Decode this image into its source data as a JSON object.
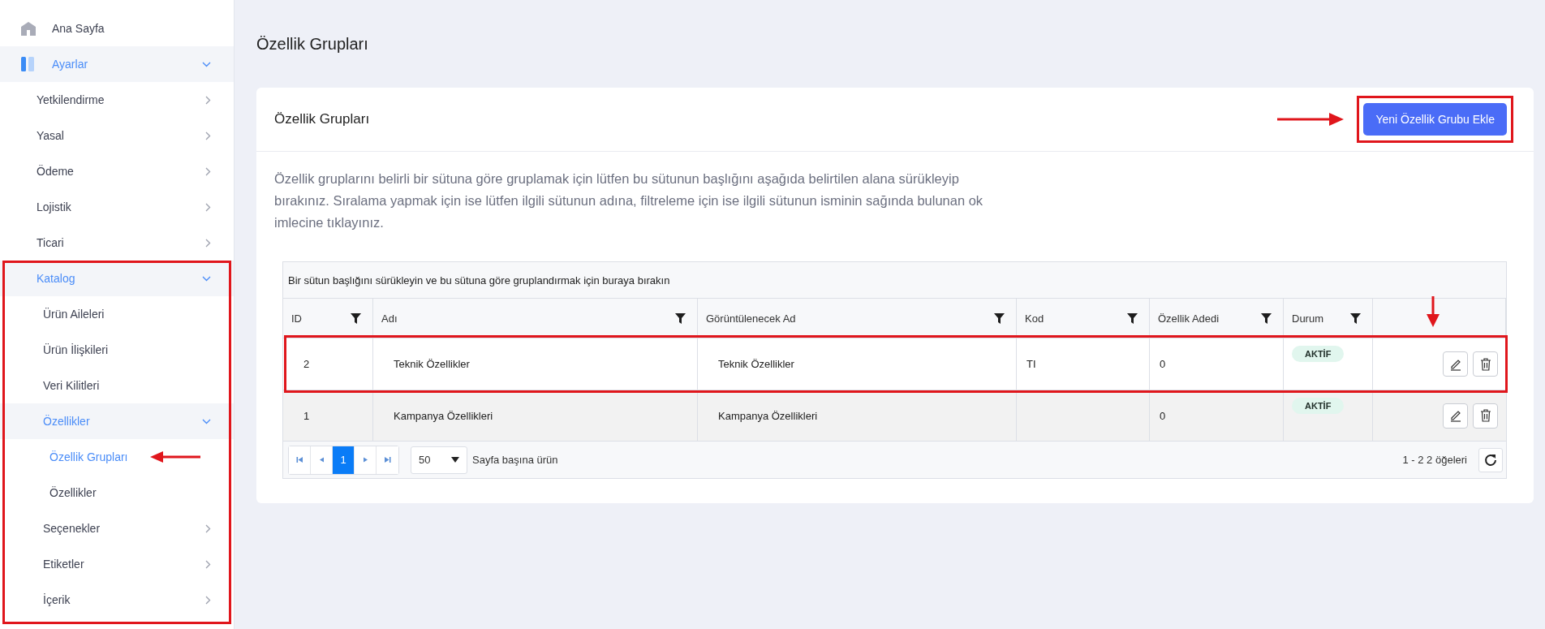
{
  "sidebar": {
    "items": [
      {
        "label": "Ana Sayfa",
        "selected": false
      },
      {
        "label": "Ayarlar",
        "expanded": true,
        "children": [
          {
            "label": "Yetkilendirme",
            "selected": false,
            "expanded": false
          },
          {
            "label": "Yasal",
            "selected": false,
            "expanded": false
          },
          {
            "label": "Ödeme",
            "selected": false,
            "expanded": false
          },
          {
            "label": "Lojistik",
            "selected": false,
            "expanded": false
          },
          {
            "label": "Ticari",
            "selected": false,
            "expanded": false
          },
          {
            "label": "Katalog",
            "expanded": true,
            "highlighted": true,
            "children": [
              {
                "label": "Ürün Aileleri",
                "selected": false
              },
              {
                "label": "Ürün İlişkileri",
                "selected": false
              },
              {
                "label": "Veri Kilitleri",
                "selected": false
              },
              {
                "label": "Özellikler",
                "expanded": true,
                "children": [
                  {
                    "label": "Özellik Grupları",
                    "selected": true,
                    "arrow": true
                  },
                  {
                    "label": "Özellikler",
                    "selected": false
                  }
                ]
              },
              {
                "label": "Seçenekler",
                "selected": false,
                "expanded": false
              },
              {
                "label": "Etiketler",
                "selected": false,
                "expanded": false
              },
              {
                "label": "İçerik",
                "selected": false,
                "expanded": false
              }
            ]
          }
        ]
      }
    ]
  },
  "page": {
    "title": "Özellik Grupları"
  },
  "card": {
    "title": "Özellik Grupları",
    "add_button": {
      "label": "Yeni Özellik Grubu Ekle",
      "highlighted": true
    },
    "description": "Özellik gruplarını belirli bir sütuna göre gruplamak için lütfen bu sütunun başlığını aşağıda belirtilen alana sürükleyip bırakınız. Sıralama yapmak için ise lütfen ilgili sütunun adına, filtreleme için ise ilgili sütunun isminin sağında bulunan ok imlecine tıklayınız.",
    "table": {
      "group_hint": "Bir sütun başlığını sürükleyin ve bu sütuna göre gruplandırmak için buraya bırakın",
      "columns": [
        {
          "label": "ID"
        },
        {
          "label": "Adı"
        },
        {
          "label": "Görüntülenecek Ad"
        },
        {
          "label": "Kod"
        },
        {
          "label": "Özellik Adedi"
        },
        {
          "label": "Durum"
        }
      ],
      "actions_arrow": true,
      "rows": [
        {
          "cells": [
            "2",
            "Teknik Özellikler",
            "Teknik Özellikler",
            "TI",
            "0"
          ],
          "status": "AKTİF",
          "highlighted": true
        },
        {
          "cells": [
            "1",
            "Kampanya Özellikleri",
            "Kampanya Özellikleri",
            "",
            "0"
          ],
          "status": "AKTİF",
          "highlighted": false
        }
      ],
      "pager": {
        "pages": [
          {
            "label": "1",
            "selected": true
          }
        ],
        "page_size": "50",
        "page_size_label": "Sayfa başına ürün",
        "summary": "1 - 2 2 öğeleri"
      }
    }
  }
}
